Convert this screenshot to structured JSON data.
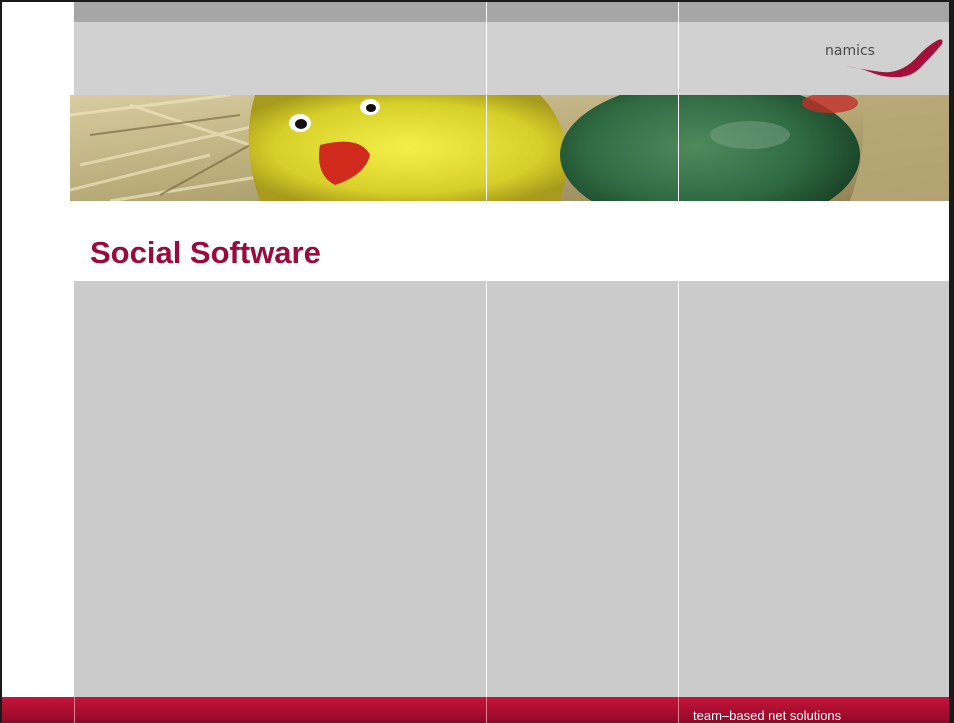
{
  "slide": {
    "title": "Social Software",
    "footer": "team–based net solutions",
    "logo_text": "namics"
  },
  "colors": {
    "title": "#9b0a3c",
    "footer_bar": "#b40f34",
    "header_gray": "#d1d1d1",
    "content_gray": "#cbcbcb",
    "logo_accent": "#a3103a"
  },
  "banner": {
    "subject": "yellow foil-wrapped chocolate chick and green easter egg on straw",
    "icon": "easter-photo-banner"
  }
}
